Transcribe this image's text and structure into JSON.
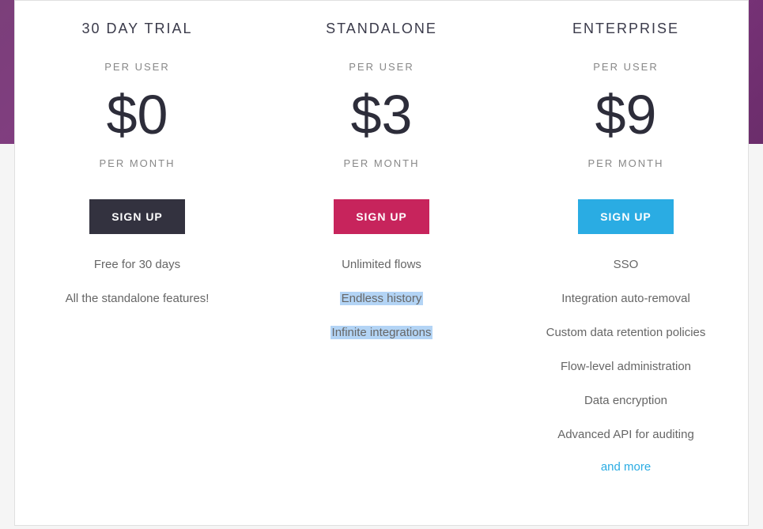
{
  "plans": {
    "trial": {
      "title": "30 DAY TRIAL",
      "per_user": "PER USER",
      "price": "$0",
      "per_month": "PER MONTH",
      "button": "SIGN UP",
      "features": {
        "f0": "Free for 30 days",
        "f1": "All the standalone features!"
      }
    },
    "standalone": {
      "title": "STANDALONE",
      "per_user": "PER USER",
      "price": "$3",
      "per_month": "PER MONTH",
      "button": "SIGN UP",
      "features": {
        "f0": "Unlimited flows",
        "f1": "Endless history",
        "f2": "Infinite integrations"
      }
    },
    "enterprise": {
      "title": "ENTERPRISE",
      "per_user": "PER USER",
      "price": "$9",
      "per_month": "PER MONTH",
      "button": "SIGN UP",
      "features": {
        "f0": "SSO",
        "f1": "Integration auto-removal",
        "f2": "Custom data retention policies",
        "f3": "Flow-level administration",
        "f4": "Data encryption",
        "f5": "Advanced API for auditing"
      },
      "and_more": "and more"
    }
  }
}
